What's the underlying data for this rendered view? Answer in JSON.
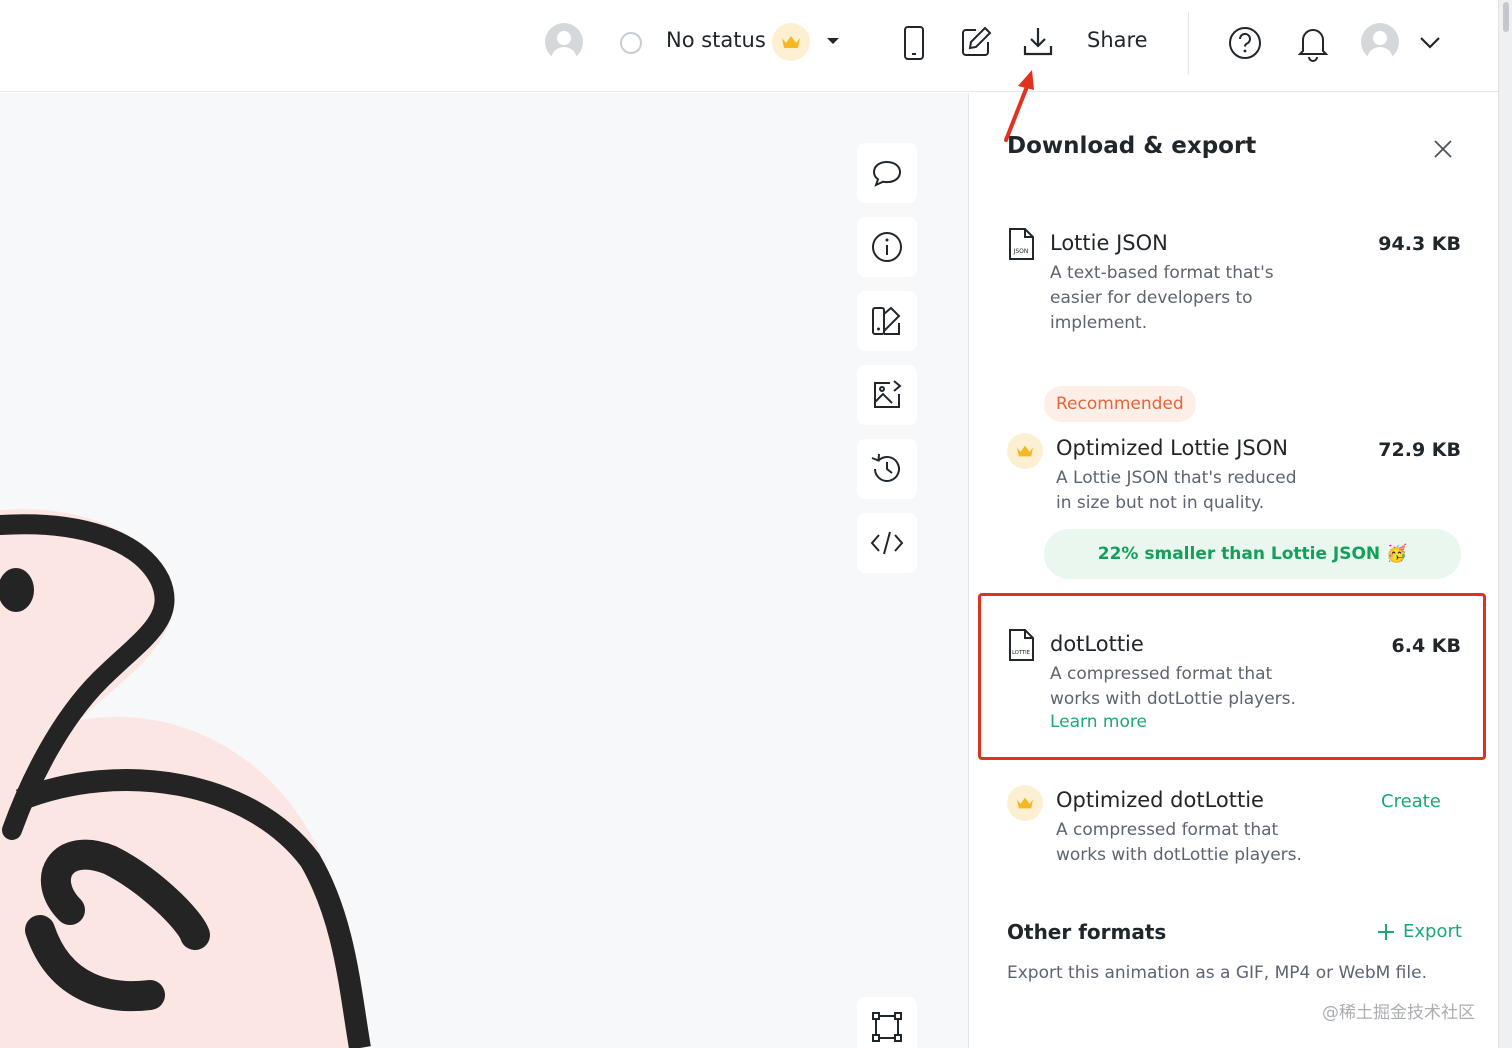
{
  "header": {
    "status_text": "No status",
    "share_label": "Share",
    "icons": [
      "user-avatar-icon",
      "status-radio-icon",
      "crown-icon",
      "caret-down-icon",
      "mobile-preview-icon",
      "edit-icon",
      "download-icon",
      "help-icon",
      "bell-icon",
      "account-avatar-icon",
      "chevron-down-icon"
    ]
  },
  "toolbar": {
    "buttons": [
      "comment-icon",
      "info-icon",
      "theme-icon",
      "image-edit-icon",
      "history-icon",
      "code-icon",
      "frame-icon"
    ]
  },
  "panel": {
    "title": "Download & export",
    "options": [
      {
        "title": "Lottie JSON",
        "desc_lines": [
          "A text-based format that's",
          "easier for developers to",
          "implement."
        ],
        "size": "94.3 KB",
        "icon": "json-file-icon"
      },
      {
        "badge": "Recommended",
        "title": "Optimized Lottie JSON",
        "desc_lines": [
          "A Lottie JSON that's reduced",
          "in size but not in quality."
        ],
        "size": "72.9 KB",
        "icon": "crown-icon",
        "savings": "22% smaller than Lottie JSON 🥳"
      },
      {
        "title": "dotLottie",
        "desc_lines": [
          "A compressed format that",
          "works with dotLottie players."
        ],
        "link": "Learn more",
        "size": "6.4 KB",
        "icon": "lottie-file-icon"
      },
      {
        "title": "Optimized dotLottie",
        "desc_lines": [
          "A compressed format that",
          "works with dotLottie players."
        ],
        "action": "Create",
        "icon": "crown-icon"
      }
    ],
    "other": {
      "title": "Other formats",
      "action": "Export",
      "desc": "Export this animation as a GIF, MP4 or WebM file."
    }
  },
  "watermark": "@稀土掘金技术社区",
  "colors": {
    "accent_green": "#19a974",
    "highlight_red": "#e0321f",
    "recommended_orange": "#e5643a",
    "crown_gold": "#f5b722"
  }
}
